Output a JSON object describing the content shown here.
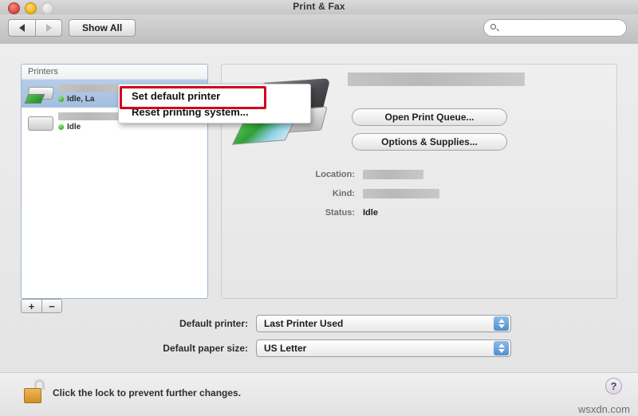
{
  "window": {
    "title": "Print & Fax",
    "controls": {
      "close": "close",
      "minimize": "minimize",
      "zoom": "zoom"
    }
  },
  "toolbar": {
    "back_label": "back",
    "forward_label": "forward",
    "show_all_label": "Show All",
    "search": {
      "value": "",
      "placeholder": ""
    }
  },
  "printer_list": {
    "header": "Printers",
    "items": [
      {
        "name_redacted": true,
        "status": "Idle, La",
        "selected": true,
        "icon": "printer-color-icon"
      },
      {
        "name_redacted": true,
        "status": "Idle",
        "selected": false,
        "icon": "printer-gray-icon"
      }
    ],
    "add_label": "+",
    "remove_label": "−"
  },
  "context_menu": {
    "items": [
      {
        "label": "Set default printer",
        "highlighted": true
      },
      {
        "label": "Reset printing system...",
        "highlighted": false
      }
    ],
    "highlight_color": "#d0021b"
  },
  "detail": {
    "printer_name_redacted": true,
    "buttons": [
      {
        "label": "Open Print Queue..."
      },
      {
        "label": "Options & Supplies..."
      }
    ],
    "info": [
      {
        "label": "Location:",
        "value": "",
        "redacted": true
      },
      {
        "label": "Kind:",
        "value": "",
        "redacted": true
      },
      {
        "label": "Status:",
        "value": "Idle",
        "redacted": false
      }
    ]
  },
  "form": {
    "rows": [
      {
        "label": "Default printer:",
        "value": "Last Printer Used"
      },
      {
        "label": "Default paper size:",
        "value": "US Letter"
      }
    ]
  },
  "footer": {
    "lock_text": "Click the lock to prevent further changes.",
    "lock_state": "unlocked",
    "help_label": "?",
    "watermark": "wsxdn.com"
  }
}
